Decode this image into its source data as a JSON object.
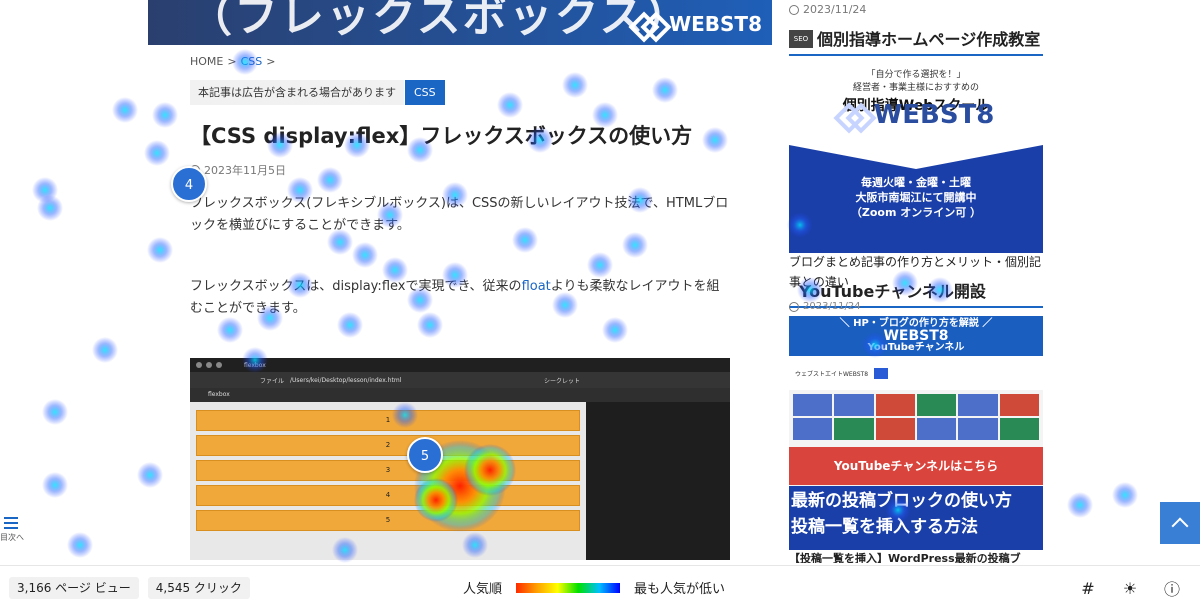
{
  "article": {
    "breadcrumb": {
      "home": "HOME",
      "sep": ">",
      "category": "CSS",
      "sep2": ">"
    },
    "ad_note": "本記事は広告が含まれる場合があります",
    "category_badge": "CSS",
    "title": "【CSS display:flex】フレックスボックスの使い方",
    "date": "2023年11月5日",
    "paragraph1": "フレックスボックス(フレキシブルボックス)は、CSSの新しいレイアウト技法で、HTMLブロックを横並びにすることができます。",
    "paragraph2_pre": "フレックスボックスは、display:flexで実現でき、従来の",
    "paragraph2_link": "float",
    "paragraph2_post": "よりも柔軟なレイアウトを組むことができます。",
    "hero_logo": "WEBST8",
    "screenshot": {
      "tab_title": "flexbox",
      "url_label": "ファイル",
      "url_path": "/Users/kei/Desktop/lesson/index.html",
      "secret_label": "シークレット",
      "bookmark": "flexbox",
      "rows": [
        "1",
        "2",
        "3",
        "4",
        "5"
      ]
    }
  },
  "sidebar": {
    "top_date": "2023/11/24",
    "heading1": "個別指導ホームページ作成教室",
    "tag": "SEO",
    "promo": {
      "line1": "「自分で作る選択を！」",
      "line2": "経営者・事業主様におすすめの",
      "line3": "個別指導Webスクール",
      "brand": "WEBST8",
      "blue_line1": "毎週火曜・金曜・土曜",
      "blue_line2": "大阪市南堀江にて開講中",
      "blue_line3": "（Zoom オンライン可 ）"
    },
    "link1": "ブログまとめ記事の作り方とメリット・個別記事との違い",
    "heading2": "YouTubeチャンネル開設",
    "mid_date": "2023/11/24",
    "yt": {
      "banner1": "＼ HP・ブログの作り方を解説 ／",
      "banner2": "WEBST8",
      "banner3": "YouTubeチャンネル",
      "channel": "ウェブストエイトWEBST8",
      "cta": "YouTubeチャンネルはこちら"
    },
    "promo2_line1": "最新の投稿ブロックの使い方",
    "promo2_line2": "投稿一覧を挿入する方法",
    "link2": "【投稿一覧を挿入】WordPress最新の投稿ブ"
  },
  "toc": {
    "label": "目次へ"
  },
  "heatmap": {
    "markers": [
      "4",
      "5"
    ]
  },
  "bottom_bar": {
    "page_views": "3,166 ページ ビュー",
    "clicks": "4,545 クリック",
    "legend_left": "人気順",
    "legend_right": "最も人気が低い"
  },
  "colors": {
    "accent": "#1a66c4",
    "brand_blue": "#1a3fa8",
    "cta_red": "#d9443c"
  }
}
